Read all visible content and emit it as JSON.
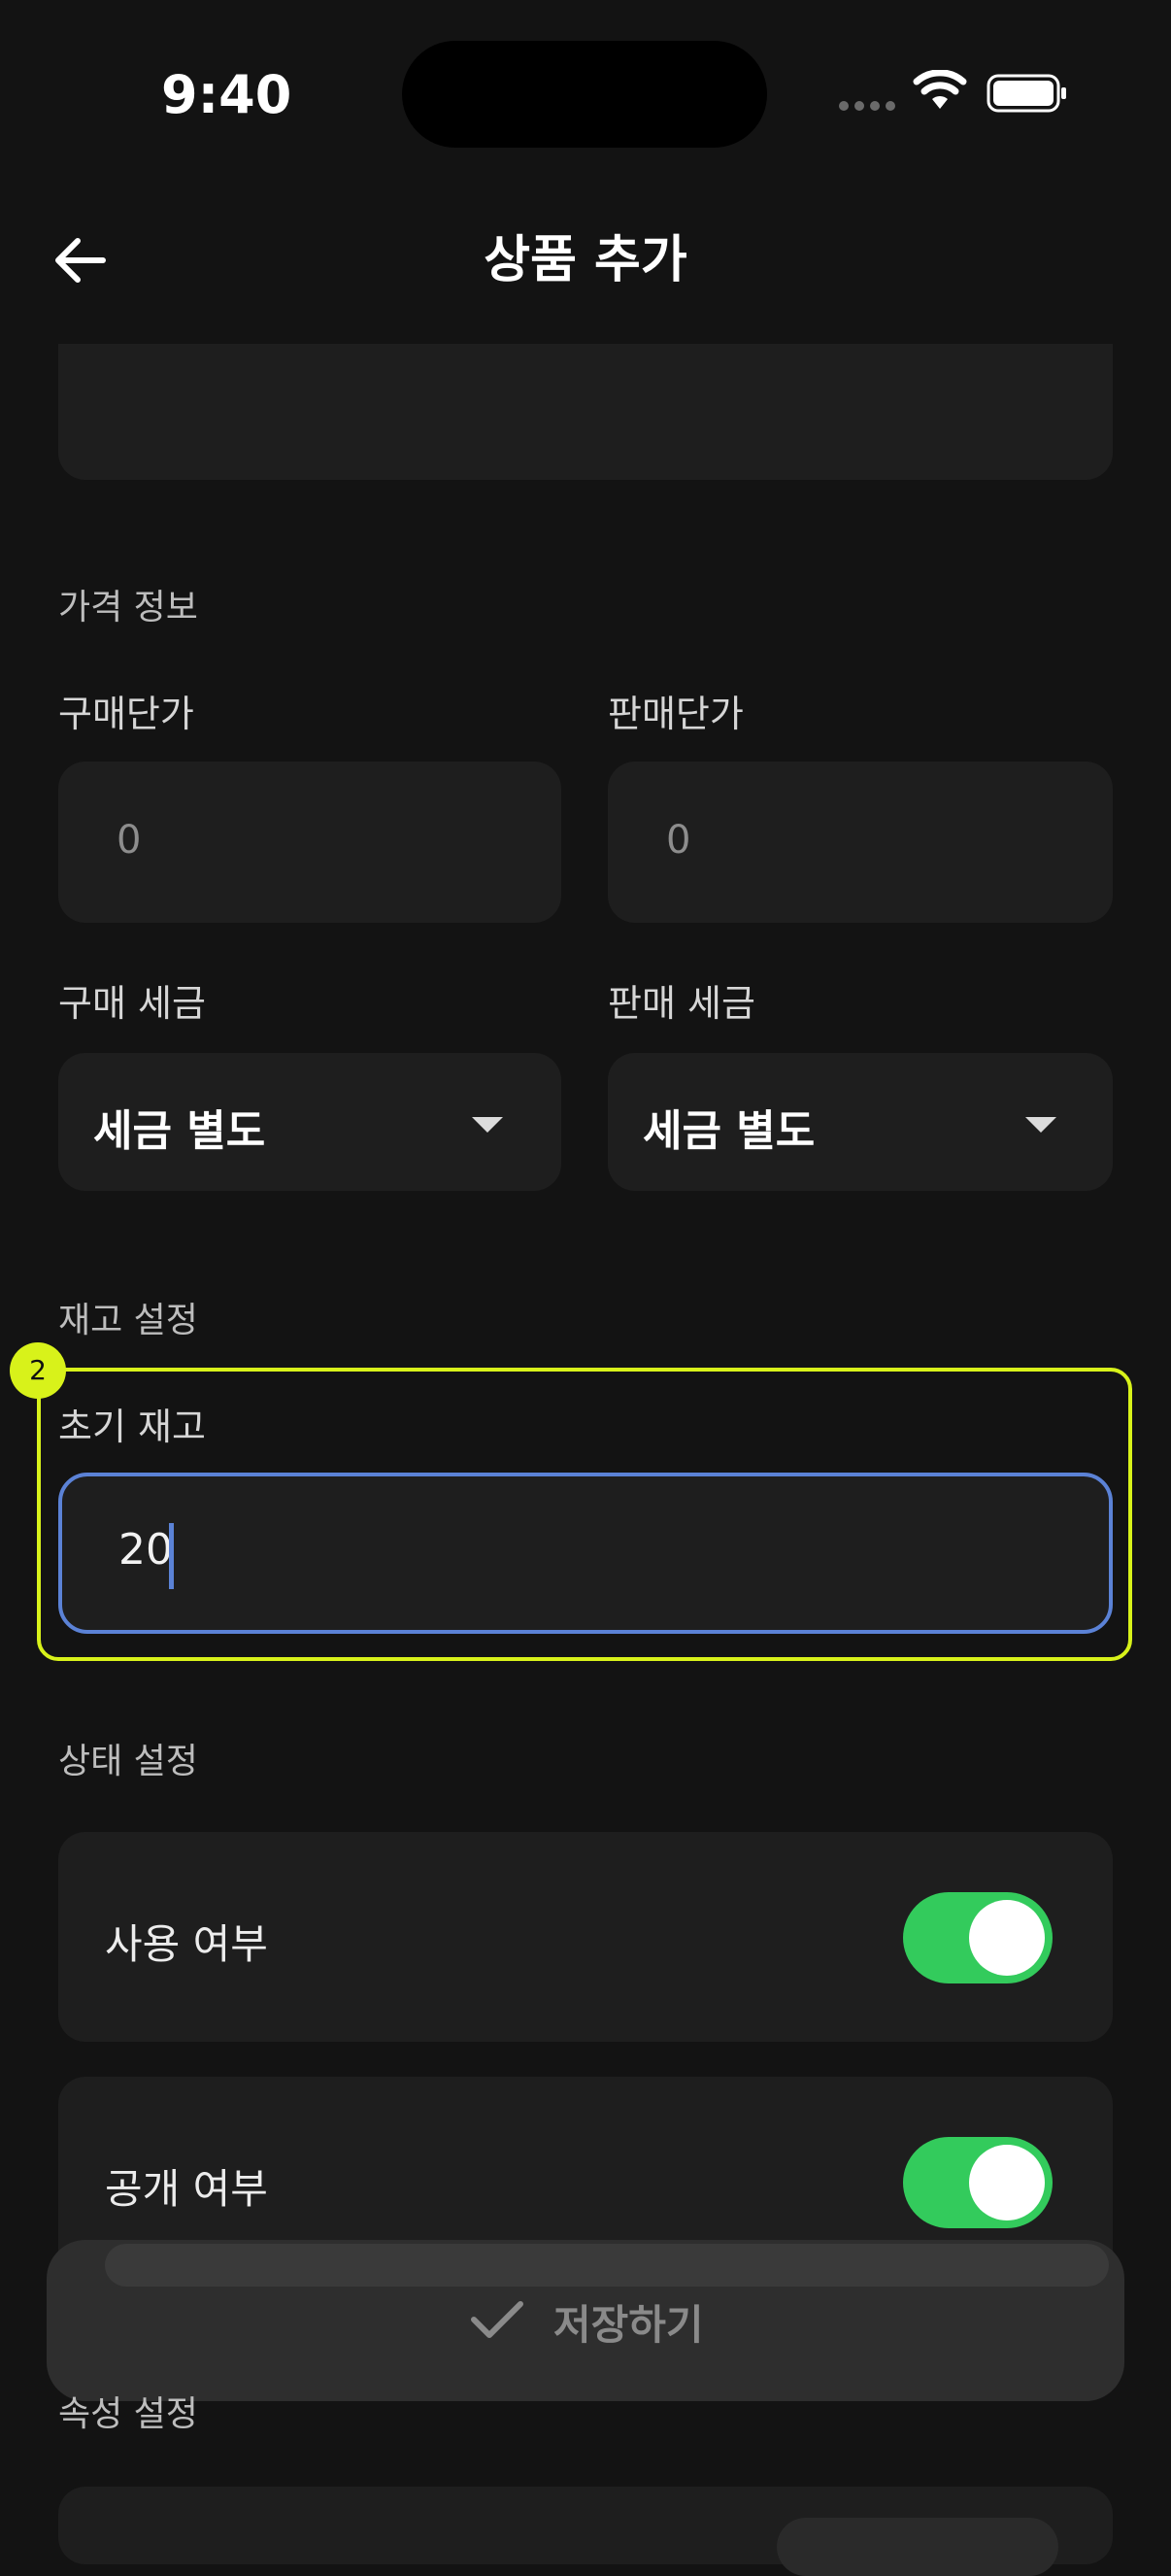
{
  "status_bar": {
    "time": "9:40"
  },
  "header": {
    "title": "상품 추가",
    "back_icon": "arrow-left-icon"
  },
  "price_section": {
    "title": "가격 정보",
    "purchase_price": {
      "label": "구매단가",
      "value": "0"
    },
    "sale_price": {
      "label": "판매단가",
      "value": "0"
    },
    "purchase_tax": {
      "label": "구매 세금",
      "selected": "세금 별도"
    },
    "sale_tax": {
      "label": "판매 세금",
      "selected": "세금 별도"
    }
  },
  "stock_section": {
    "title": "재고 설정",
    "badge": "2",
    "initial_stock": {
      "label": "초기 재고",
      "value": "20"
    }
  },
  "status_section": {
    "title": "상태 설정",
    "use_toggle": {
      "label": "사용 여부",
      "on": true
    },
    "public_toggle": {
      "label": "공개 여부",
      "on": true
    }
  },
  "save": {
    "label": "저장하기",
    "icon": "check-icon"
  },
  "attribute_section": {
    "title": "속성 설정"
  },
  "colors": {
    "accent_green": "#33cb5c",
    "focus_blue": "#5b82d6",
    "highlight": "#d8f21a"
  }
}
